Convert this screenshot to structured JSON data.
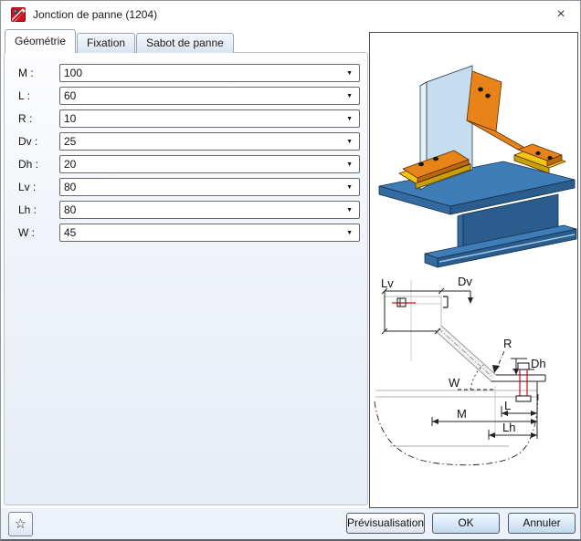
{
  "window": {
    "title": "Jonction de panne (1204)",
    "close_glyph": "×"
  },
  "tabs": [
    {
      "label": "Géométrie",
      "active": true
    },
    {
      "label": "Fixation",
      "active": false
    },
    {
      "label": "Sabot de panne",
      "active": false
    }
  ],
  "fields": [
    {
      "name": "M",
      "label": "M :",
      "value": "100"
    },
    {
      "name": "L",
      "label": "L :",
      "value": "60"
    },
    {
      "name": "R",
      "label": "R :",
      "value": "10"
    },
    {
      "name": "Dv",
      "label": "Dv :",
      "value": "25"
    },
    {
      "name": "Dh",
      "label": "Dh :",
      "value": "20"
    },
    {
      "name": "Lv",
      "label": "Lv :",
      "value": "80"
    },
    {
      "name": "Lh",
      "label": "Lh :",
      "value": "80"
    },
    {
      "name": "W",
      "label": "W :",
      "value": "45"
    }
  ],
  "footer": {
    "favorite_glyph": "☆",
    "preview_label": "Prévisualisation",
    "ok_label": "OK",
    "cancel_label": "Annuler"
  },
  "diagram": {
    "labels": {
      "lv": "Lv",
      "dv": "Dv",
      "r": "R",
      "dh": "Dh",
      "w": "W",
      "m": "M",
      "l": "L",
      "lh": "Lh"
    }
  },
  "colors": {
    "beam_top": "#3f7db8",
    "beam_front": "#2b5c8e",
    "beam_side": "#356a9f",
    "beam_highlight": "#9fc6e4",
    "plate_front": "#c5ddee",
    "plate_side": "#e6f2fa",
    "plate_top": "#d5e8f4",
    "bracket": "#e8831a",
    "bracket_dark": "#bd670e",
    "pad": "#f3c50e",
    "pad_dark": "#c79f08",
    "bolt_red": "#cc1111",
    "title_icon_red": "#cf1420"
  }
}
